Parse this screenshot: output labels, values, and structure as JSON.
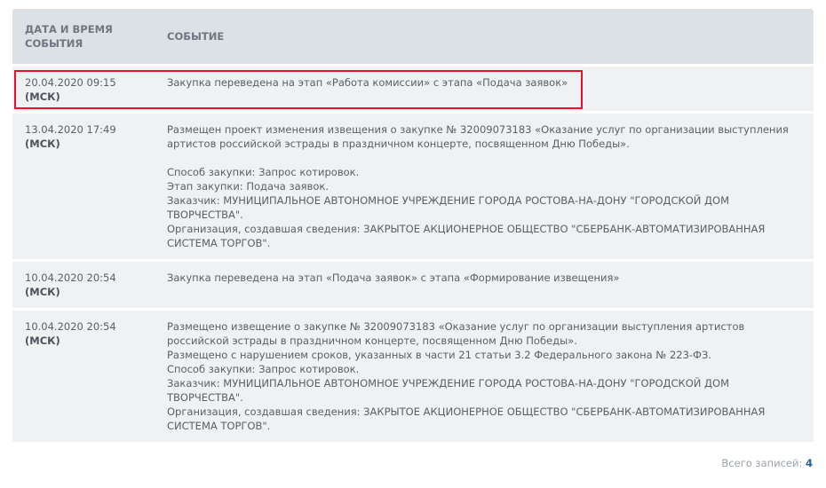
{
  "table": {
    "headers": {
      "date": "ДАТА И ВРЕМЯ\nСОБЫТИЯ",
      "event": "СОБЫТИЕ"
    },
    "rows": [
      {
        "date": "20.04.2020 09:15",
        "tz": "(МСК)",
        "lines": [
          "Закупка переведена на этап «Работа комиссии» с этапа «Подача заявок»"
        ]
      },
      {
        "date": "13.04.2020 17:49",
        "tz": "(МСК)",
        "lines": [
          "Размещен проект изменения извещения о закупке № 32009073183 «Оказание услуг по организации выступления артистов российской эстрады в праздничном концерте, посвященном Дню Победы».",
          "",
          "Способ закупки: Запрос котировок.",
          "Этап закупки: Подача заявок.",
          "Заказчик: МУНИЦИПАЛЬНОЕ АВТОНОМНОЕ УЧРЕЖДЕНИЕ ГОРОДА РОСТОВА-НА-ДОНУ \"ГОРОДСКОЙ ДОМ ТВОРЧЕСТВА\".",
          "Организация, создавшая сведения: ЗАКРЫТОЕ АКЦИОНЕРНОЕ ОБЩЕСТВО \"СБЕРБАНК-АВТОМАТИЗИРОВАННАЯ СИСТЕМА ТОРГОВ\"."
        ]
      },
      {
        "date": "10.04.2020 20:54",
        "tz": "(МСК)",
        "lines": [
          "Закупка переведена на этап «Подача заявок» с этапа «Формирование извещения»"
        ]
      },
      {
        "date": "10.04.2020 20:54",
        "tz": "(МСК)",
        "lines": [
          "Размещено извещение о закупке № 32009073183 «Оказание услуг по организации выступления артистов российской эстрады в праздничном концерте, посвященном Дню Победы».",
          "Размещено с нарушением сроков, указанных в части 21 статьи 3.2 Федерального закона № 223-ФЗ.",
          "Способ закупки: Запрос котировок.",
          "Заказчик: МУНИЦИПАЛЬНОЕ АВТОНОМНОЕ УЧРЕЖДЕНИЕ ГОРОДА РОСТОВА-НА-ДОНУ \"ГОРОДСКОЙ ДОМ ТВОРЧЕСТВА\".",
          "Организация, создавшая сведения: ЗАКРЫТОЕ АКЦИОНЕРНОЕ ОБЩЕСТВО \"СБЕРБАНК-АВТОМАТИЗИРОВАННАЯ СИСТЕМА ТОРГОВ\"."
        ]
      }
    ]
  },
  "footer": {
    "total_label": "Всего записей:",
    "total_count": "4"
  },
  "colors": {
    "header_bg": "#dce1e6",
    "row_bg": "#eff1f3",
    "highlight": "#e8102a",
    "count": "#2c5d8f"
  }
}
